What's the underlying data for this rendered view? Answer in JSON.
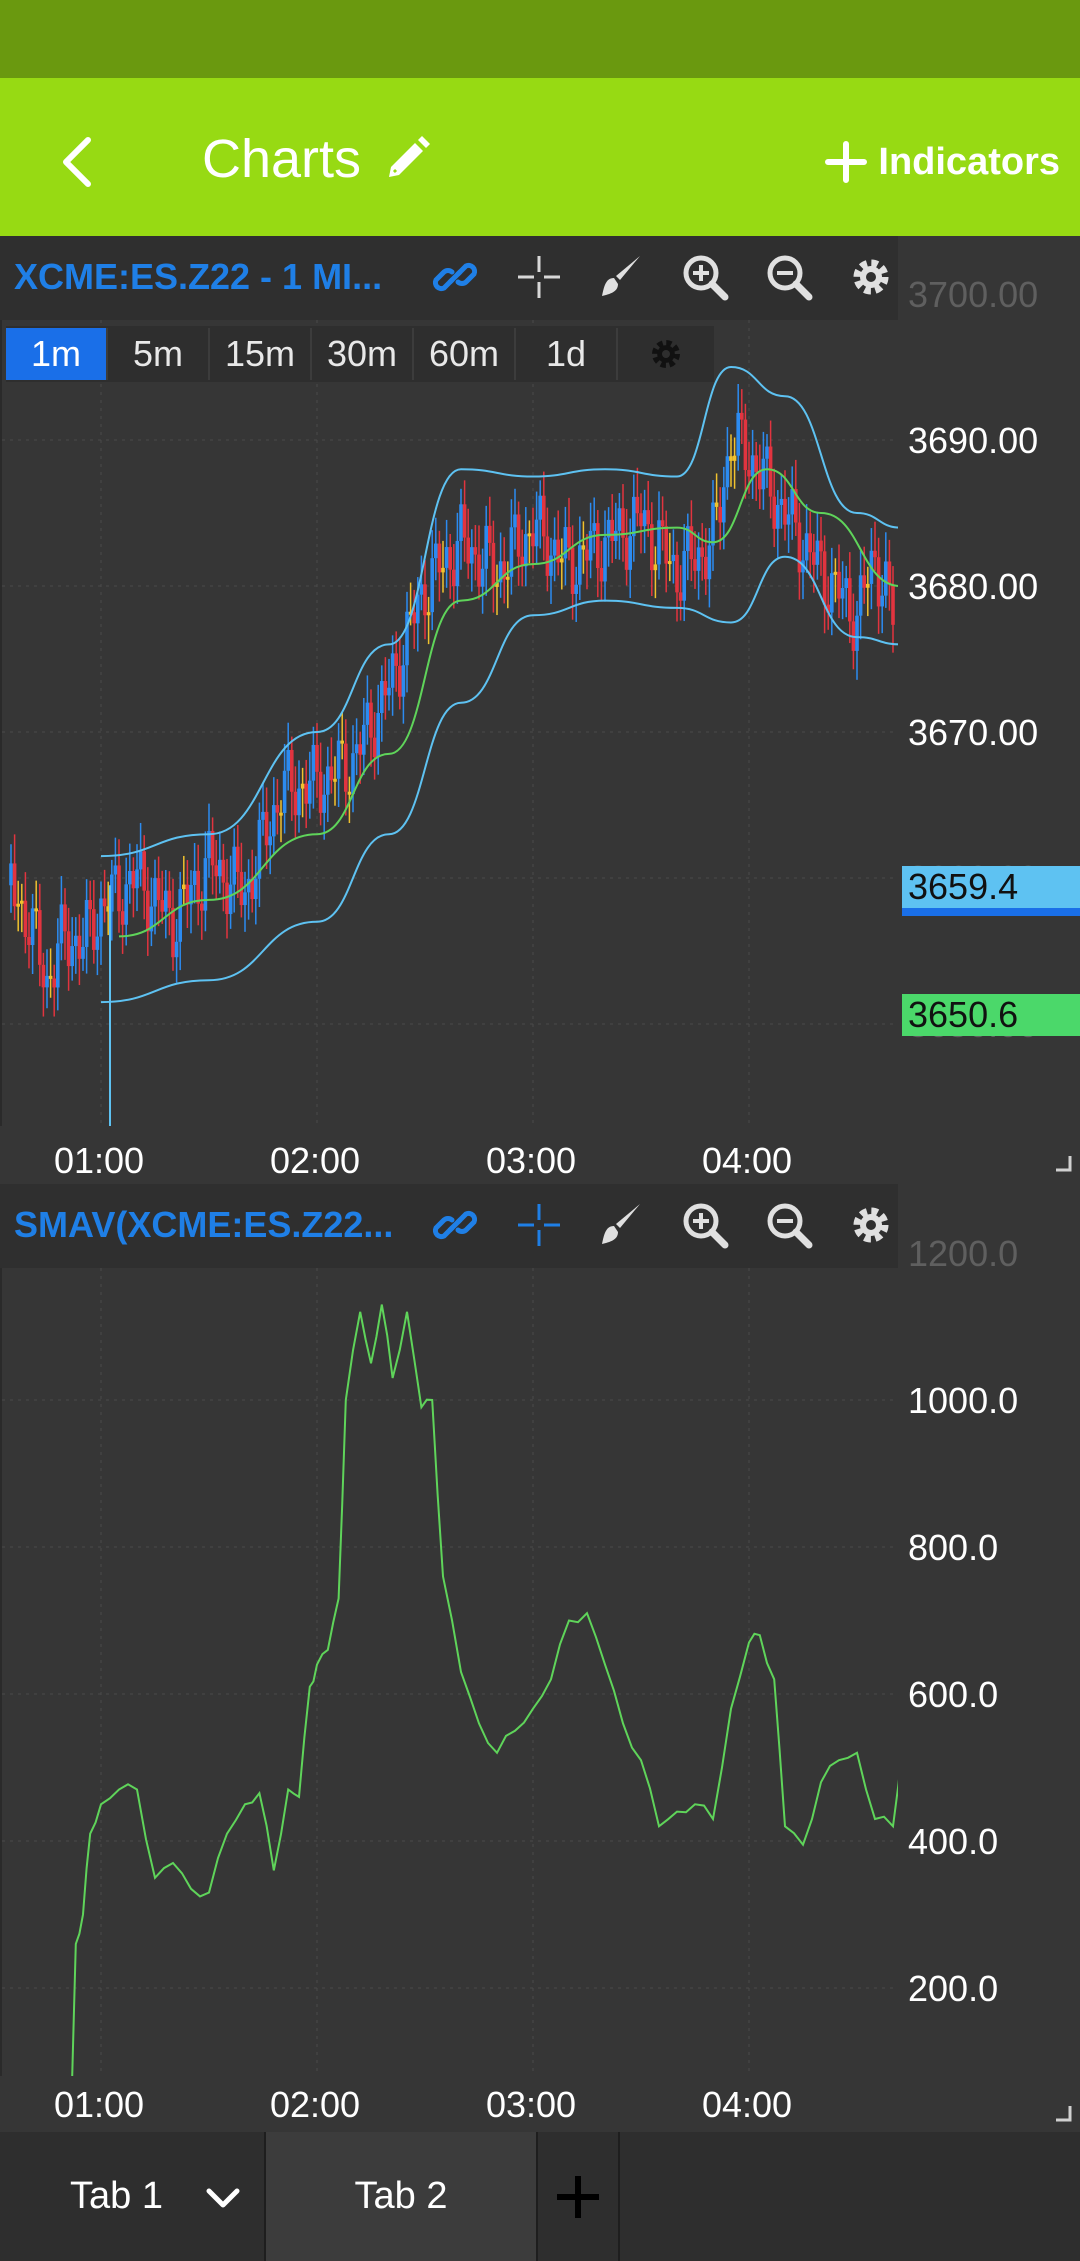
{
  "appbar": {
    "title": "Charts",
    "indicators_label": "Indicators"
  },
  "colors": {
    "appbar": "#97da13",
    "statusbar": "#6a990f",
    "accent_blue": "#1f7fe6",
    "candle_up": "#2c8bf0",
    "candle_down": "#e2343f",
    "sma_line": "#5fd45a",
    "band_line": "#5ec2f2",
    "bg": "#363636"
  },
  "icons": [
    "back-icon",
    "pencil-icon",
    "plus-icon",
    "link-icon",
    "crosshair-icon",
    "brush-icon",
    "zoom-in-icon",
    "zoom-out-icon",
    "gear-icon",
    "trash-icon",
    "lock-icon",
    "chevron-down-icon"
  ],
  "price_chart": {
    "title": "XCME:ES.Z22 - 1 MI...",
    "timeframes": [
      "1m",
      "5m",
      "15m",
      "30m",
      "60m",
      "1d"
    ],
    "active_timeframe": "1m",
    "y_ticks": [
      "3700.00",
      "3690.00",
      "3680.00",
      "3670.00",
      "3660.00",
      "3650.00"
    ],
    "price_tags": [
      {
        "text": "3659.4",
        "color": "#5ec2f2"
      },
      {
        "text": "3650.6",
        "color": "#4bd86a"
      }
    ]
  },
  "volume_chart": {
    "title": "SMAV(XCME:ES.Z22...",
    "y_ticks": [
      "1200.0",
      "1000.0",
      "800.0",
      "600.0",
      "400.0",
      "200.0"
    ]
  },
  "x_ticks": [
    "01:00",
    "02:00",
    "03:00",
    "04:00"
  ],
  "tabs": {
    "tab1": "Tab 1",
    "tab2": "Tab 2"
  },
  "chart_data": [
    {
      "type": "candlestick",
      "title": "XCME:ES.Z22 - 1 MI...",
      "x_ticks": [
        "01:00",
        "02:00",
        "03:00",
        "04:00"
      ],
      "x_range": [
        "00:35",
        "04:43"
      ],
      "ylim": [
        3643,
        3705
      ],
      "grid": true,
      "close_anchors": [
        {
          "time": "00:35",
          "value": 3659.5
        },
        {
          "time": "00:40",
          "value": 3657.0
        },
        {
          "time": "00:45",
          "value": 3653.0
        },
        {
          "time": "00:50",
          "value": 3656.0
        },
        {
          "time": "00:55",
          "value": 3655.5
        },
        {
          "time": "01:00",
          "value": 3658.0
        },
        {
          "time": "01:10",
          "value": 3660.0
        },
        {
          "time": "01:20",
          "value": 3657.0
        },
        {
          "time": "01:30",
          "value": 3661.0
        },
        {
          "time": "01:40",
          "value": 3659.0
        },
        {
          "time": "01:50",
          "value": 3666.0
        },
        {
          "time": "02:00",
          "value": 3666.5
        },
        {
          "time": "02:10",
          "value": 3668.0
        },
        {
          "time": "02:20",
          "value": 3673.0
        },
        {
          "time": "02:30",
          "value": 3680.0
        },
        {
          "time": "02:40",
          "value": 3683.0
        },
        {
          "time": "02:50",
          "value": 3681.0
        },
        {
          "time": "03:00",
          "value": 3684.0
        },
        {
          "time": "03:10",
          "value": 3681.5
        },
        {
          "time": "03:20",
          "value": 3683.0
        },
        {
          "time": "03:30",
          "value": 3684.5
        },
        {
          "time": "03:40",
          "value": 3681.0
        },
        {
          "time": "03:50",
          "value": 3683.0
        },
        {
          "time": "03:55",
          "value": 3690.0
        },
        {
          "time": "04:00",
          "value": 3689.0
        },
        {
          "time": "04:10",
          "value": 3685.0
        },
        {
          "time": "04:20",
          "value": 3681.0
        },
        {
          "time": "04:30",
          "value": 3678.0
        },
        {
          "time": "04:35",
          "value": 3682.0
        },
        {
          "time": "04:40",
          "value": 3678.0
        }
      ],
      "series": [
        {
          "name": "SMA",
          "color": "#5fd45a",
          "points": [
            {
              "time": "01:05",
              "value": 3656.0
            },
            {
              "time": "01:30",
              "value": 3658.5
            },
            {
              "time": "02:00",
              "value": 3663.0
            },
            {
              "time": "02:20",
              "value": 3668.5
            },
            {
              "time": "02:40",
              "value": 3679.0
            },
            {
              "time": "03:00",
              "value": 3681.5
            },
            {
              "time": "03:20",
              "value": 3683.5
            },
            {
              "time": "03:40",
              "value": 3684.0
            },
            {
              "time": "03:50",
              "value": 3683.0
            },
            {
              "time": "04:05",
              "value": 3688.0
            },
            {
              "time": "04:20",
              "value": 3685.0
            },
            {
              "time": "04:42",
              "value": 3680.0
            }
          ]
        },
        {
          "name": "Upper band",
          "color": "#5ec2f2",
          "points": [
            {
              "time": "01:00",
              "value": 3661.5
            },
            {
              "time": "01:30",
              "value": 3663.0
            },
            {
              "time": "02:00",
              "value": 3670.0
            },
            {
              "time": "02:20",
              "value": 3676.0
            },
            {
              "time": "02:40",
              "value": 3688.0
            },
            {
              "time": "03:00",
              "value": 3687.5
            },
            {
              "time": "03:20",
              "value": 3688.0
            },
            {
              "time": "03:40",
              "value": 3687.5
            },
            {
              "time": "03:55",
              "value": 3695.0
            },
            {
              "time": "04:10",
              "value": 3693.0
            },
            {
              "time": "04:30",
              "value": 3685.0
            },
            {
              "time": "04:42",
              "value": 3684.0
            }
          ]
        },
        {
          "name": "Lower band",
          "color": "#5ec2f2",
          "points": [
            {
              "time": "01:00",
              "value": 3651.5
            },
            {
              "time": "01:30",
              "value": 3653.0
            },
            {
              "time": "02:00",
              "value": 3657.0
            },
            {
              "time": "02:20",
              "value": 3663.0
            },
            {
              "time": "02:40",
              "value": 3672.0
            },
            {
              "time": "03:00",
              "value": 3678.0
            },
            {
              "time": "03:20",
              "value": 3679.0
            },
            {
              "time": "03:40",
              "value": 3678.5
            },
            {
              "time": "03:55",
              "value": 3677.5
            },
            {
              "time": "04:10",
              "value": 3682.0
            },
            {
              "time": "04:30",
              "value": 3676.5
            },
            {
              "time": "04:42",
              "value": 3676.0
            }
          ]
        }
      ]
    },
    {
      "type": "line",
      "title": "SMAV(XCME:ES.Z22...",
      "x_ticks": [
        "01:00",
        "02:00",
        "03:00",
        "04:00"
      ],
      "ylim": [
        80,
        1230
      ],
      "grid": true,
      "series": [
        {
          "name": "SMAV",
          "color": "#5fd45a",
          "points": [
            {
              "time": "00:52",
              "value": 80
            },
            {
              "time": "00:53",
              "value": 260
            },
            {
              "time": "00:55",
              "value": 300
            },
            {
              "time": "00:57",
              "value": 410
            },
            {
              "time": "01:00",
              "value": 450
            },
            {
              "time": "01:05",
              "value": 470
            },
            {
              "time": "01:10",
              "value": 470
            },
            {
              "time": "01:15",
              "value": 350
            },
            {
              "time": "01:20",
              "value": 370
            },
            {
              "time": "01:25",
              "value": 335
            },
            {
              "time": "01:30",
              "value": 330
            },
            {
              "time": "01:35",
              "value": 410
            },
            {
              "time": "01:40",
              "value": 450
            },
            {
              "time": "01:44",
              "value": 465
            },
            {
              "time": "01:48",
              "value": 360
            },
            {
              "time": "01:52",
              "value": 470
            },
            {
              "time": "01:55",
              "value": 460
            },
            {
              "time": "01:58",
              "value": 610
            },
            {
              "time": "02:00",
              "value": 640
            },
            {
              "time": "02:03",
              "value": 660
            },
            {
              "time": "02:06",
              "value": 730
            },
            {
              "time": "02:08",
              "value": 1000
            },
            {
              "time": "02:12",
              "value": 1120
            },
            {
              "time": "02:15",
              "value": 1050
            },
            {
              "time": "02:18",
              "value": 1130
            },
            {
              "time": "02:21",
              "value": 1030
            },
            {
              "time": "02:25",
              "value": 1120
            },
            {
              "time": "02:29",
              "value": 990
            },
            {
              "time": "02:32",
              "value": 1000
            },
            {
              "time": "02:35",
              "value": 760
            },
            {
              "time": "02:40",
              "value": 630
            },
            {
              "time": "02:45",
              "value": 560
            },
            {
              "time": "02:50",
              "value": 520
            },
            {
              "time": "02:55",
              "value": 550
            },
            {
              "time": "03:00",
              "value": 580
            },
            {
              "time": "03:05",
              "value": 620
            },
            {
              "time": "03:10",
              "value": 700
            },
            {
              "time": "03:15",
              "value": 710
            },
            {
              "time": "03:20",
              "value": 640
            },
            {
              "time": "03:25",
              "value": 560
            },
            {
              "time": "03:30",
              "value": 510
            },
            {
              "time": "03:35",
              "value": 420
            },
            {
              "time": "03:40",
              "value": 440
            },
            {
              "time": "03:45",
              "value": 450
            },
            {
              "time": "03:50",
              "value": 430
            },
            {
              "time": "03:55",
              "value": 580
            },
            {
              "time": "04:00",
              "value": 670
            },
            {
              "time": "04:03",
              "value": 680
            },
            {
              "time": "04:07",
              "value": 620
            },
            {
              "time": "04:10",
              "value": 420
            },
            {
              "time": "04:15",
              "value": 395
            },
            {
              "time": "04:20",
              "value": 480
            },
            {
              "time": "04:25",
              "value": 510
            },
            {
              "time": "04:30",
              "value": 520
            },
            {
              "time": "04:35",
              "value": 430
            },
            {
              "time": "04:40",
              "value": 420
            },
            {
              "time": "04:43",
              "value": 545
            }
          ]
        }
      ]
    }
  ]
}
